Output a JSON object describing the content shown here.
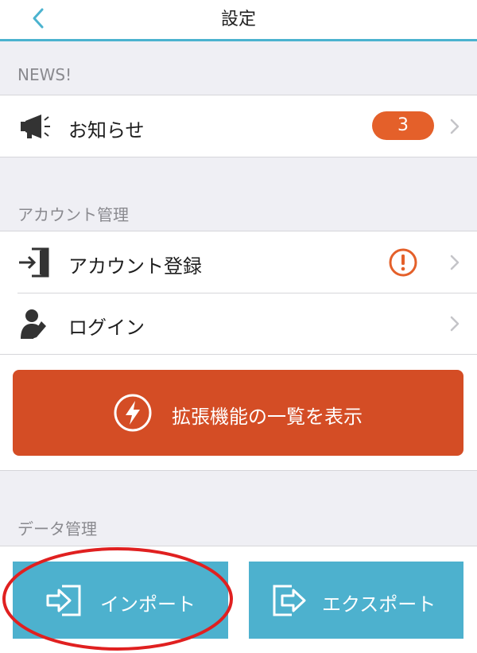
{
  "header": {
    "title": "設定"
  },
  "news_section": {
    "header": "NEWS!",
    "items": [
      {
        "label": "お知らせ",
        "badge": "3"
      }
    ]
  },
  "account_section": {
    "header": "アカウント管理",
    "items": [
      {
        "label": "アカウント登録"
      },
      {
        "label": "ログイン"
      }
    ]
  },
  "features_button": {
    "label": "拡張機能の一覧を表示"
  },
  "data_section": {
    "header": "データ管理",
    "import_label": "インポート",
    "export_label": "エクスポート"
  },
  "colors": {
    "accent": "#4bb3cf",
    "badge": "#e4602a",
    "feature_button": "#d44d25",
    "data_button": "#4db1ce",
    "annotation": "#e02020"
  }
}
